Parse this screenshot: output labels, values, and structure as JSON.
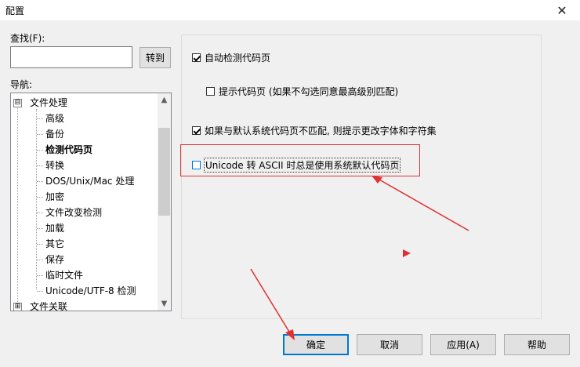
{
  "window": {
    "title": "配置"
  },
  "search": {
    "label": "查找(F):",
    "value": "",
    "goto_label": "转到"
  },
  "nav": {
    "label": "导航:",
    "items": [
      {
        "label": "文件处理",
        "level": 0,
        "expander": "⊟"
      },
      {
        "label": "高级",
        "level": 1
      },
      {
        "label": "备份",
        "level": 1
      },
      {
        "label": "检测代码页",
        "level": 1,
        "selected": true
      },
      {
        "label": "转换",
        "level": 1
      },
      {
        "label": "DOS/Unix/Mac 处理",
        "level": 1
      },
      {
        "label": "加密",
        "level": 1
      },
      {
        "label": "文件改变检测",
        "level": 1
      },
      {
        "label": "加载",
        "level": 1
      },
      {
        "label": "其它",
        "level": 1
      },
      {
        "label": "保存",
        "level": 1
      },
      {
        "label": "临时文件",
        "level": 1
      },
      {
        "label": "Unicode/UTF-8 检测",
        "level": 1
      },
      {
        "label": "文件关联",
        "level": 0,
        "expander": "⊞"
      }
    ]
  },
  "options": {
    "auto_detect": {
      "label": "自动检测代码页",
      "checked": true
    },
    "prompt_codepage": {
      "label": "提示代码页 (如果不勾选同意最高级别匹配)",
      "checked": false
    },
    "prompt_change_font": {
      "label": "如果与默认系统代码页不匹配, 则提示更改字体和字符集",
      "checked": true
    },
    "unicode_to_ascii": {
      "label": "Unicode 转 ASCII 时总是使用系统默认代码页",
      "checked": false
    }
  },
  "buttons": {
    "ok": "确定",
    "cancel": "取消",
    "apply": "应用(A)",
    "help": "帮助"
  },
  "colors": {
    "annotation_red": "#e03030",
    "focus_blue": "#0078d7"
  }
}
